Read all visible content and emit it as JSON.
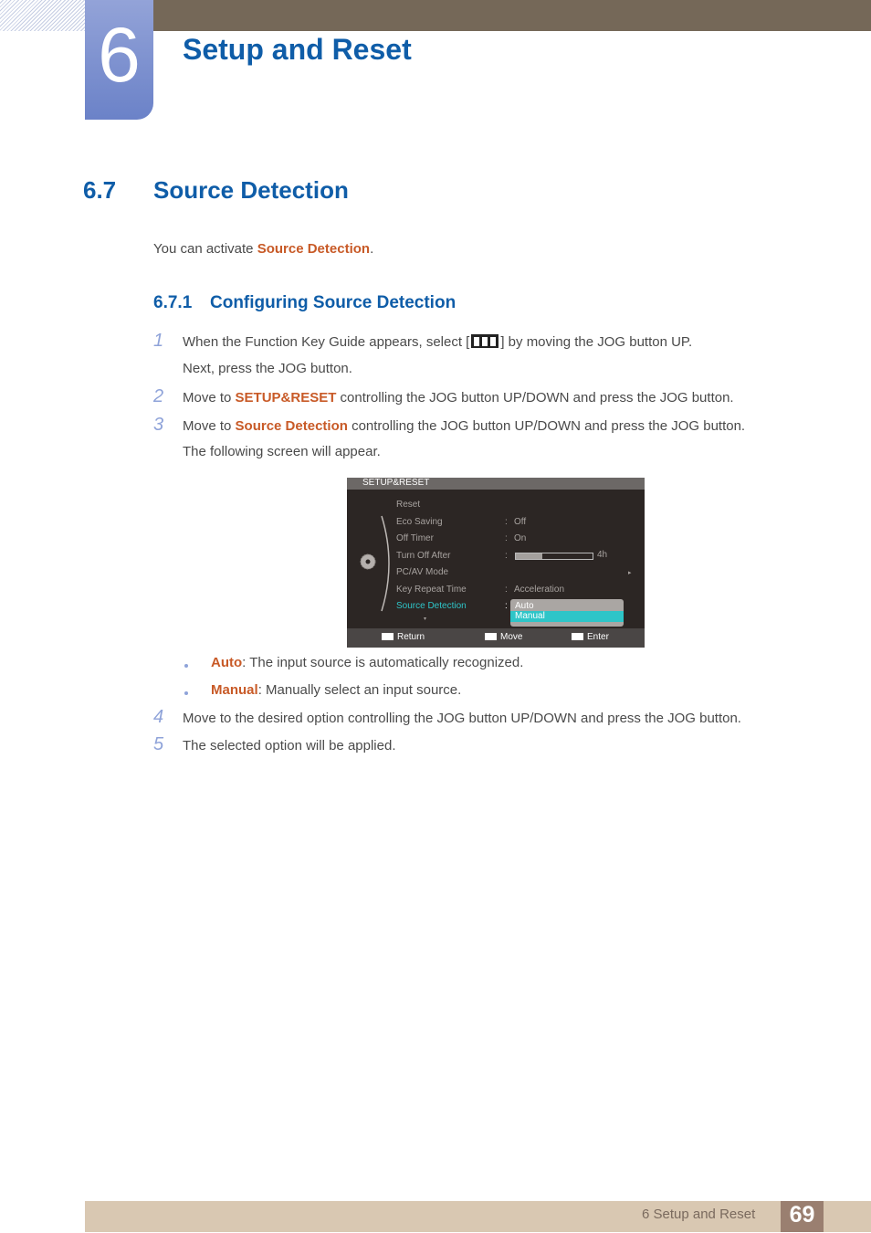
{
  "header": {
    "chapter_number": "6",
    "chapter_title": "Setup and Reset"
  },
  "section": {
    "number": "6.7",
    "title": "Source Detection",
    "intro_prefix": "You can activate ",
    "intro_highlight": "Source Detection",
    "intro_suffix": "."
  },
  "subsection": {
    "number": "6.7.1",
    "title": "Configuring Source Detection"
  },
  "steps": [
    {
      "num": "1",
      "text_a": "When the Function Key Guide appears, select [",
      "icon": "menu-icon",
      "text_b": "] by moving the JOG button UP.",
      "line2": "Next, press the JOG button."
    },
    {
      "num": "2",
      "prefix": "Move to ",
      "highlight": "SETUP&RESET",
      "suffix": " controlling the JOG button UP/DOWN and press the JOG button."
    },
    {
      "num": "3",
      "prefix": "Move to ",
      "highlight": "Source Detection",
      "suffix": " controlling the JOG button UP/DOWN and press the JOG button.",
      "line2": "The following screen will appear."
    },
    {
      "num": "4",
      "text": "Move to the desired option controlling the JOG button UP/DOWN and press the JOG button."
    },
    {
      "num": "5",
      "text": "The selected option will be applied."
    }
  ],
  "options": [
    {
      "label": "Auto",
      "desc": ": The input source is automatically recognized."
    },
    {
      "label": "Manual",
      "desc": ": Manually select an input source."
    }
  ],
  "osd": {
    "title": "SETUP&RESET",
    "items": [
      {
        "label": "Reset",
        "value": ""
      },
      {
        "label": "Eco Saving",
        "value": "Off"
      },
      {
        "label": "Off Timer",
        "value": "On"
      },
      {
        "label": "Turn Off After",
        "value": "4h",
        "bar_fraction": 0.35
      },
      {
        "label": "PC/AV Mode",
        "value": "▸"
      },
      {
        "label": "Key Repeat Time",
        "value": "Acceleration"
      },
      {
        "label": "Source Detection",
        "value": ""
      }
    ],
    "dropdown": {
      "options": [
        "Auto",
        "Manual"
      ],
      "selected": "Manual"
    },
    "footer": {
      "return": "Return",
      "move": "Move",
      "enter": "Enter"
    },
    "more_arrow": "▾"
  },
  "footer": {
    "chapter_label": "6 Setup and Reset",
    "page": "69"
  },
  "colors": {
    "heading_blue": "#0f5da8",
    "highlight_orange": "#c85a27",
    "osd_cyan": "#2ec5c8"
  }
}
